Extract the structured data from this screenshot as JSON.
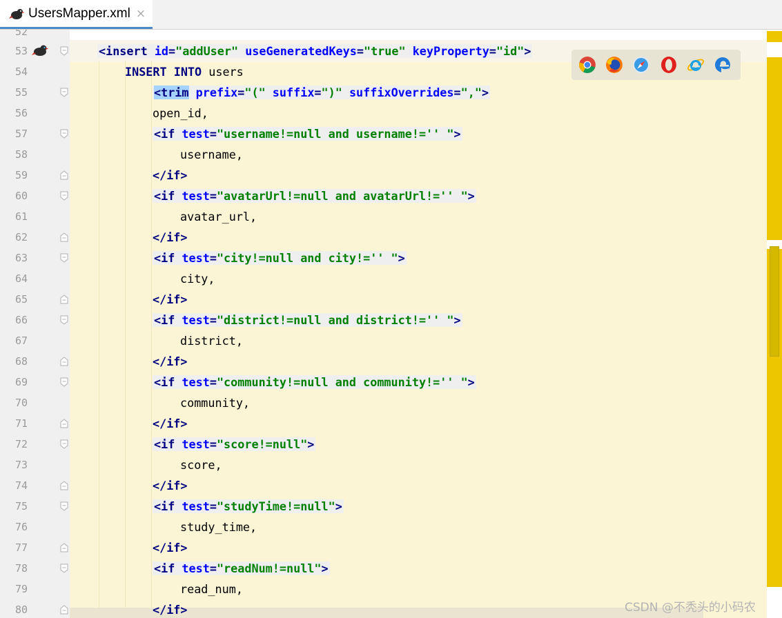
{
  "tab": {
    "title": "UsersMapper.xml",
    "close_glyph": "×",
    "icon": "mybatis-bird-icon"
  },
  "editor": {
    "first_partial_line_number": "52",
    "line_numbers": [
      "53",
      "54",
      "55",
      "56",
      "57",
      "58",
      "59",
      "60",
      "61",
      "62",
      "63",
      "64",
      "65",
      "66",
      "67",
      "68",
      "69",
      "70",
      "71",
      "72",
      "73",
      "74",
      "75",
      "76",
      "77",
      "78",
      "79",
      "80"
    ],
    "lines": [
      {
        "num": "53",
        "indent": 1,
        "boxed": true,
        "tokens": [
          [
            "t-tag",
            "<insert "
          ],
          [
            "t-attr",
            "id"
          ],
          [
            "t-tag",
            "="
          ],
          [
            "t-val",
            "\"addUser\" "
          ],
          [
            "t-attr",
            "useGeneratedKeys"
          ],
          [
            "t-tag",
            "="
          ],
          [
            "t-val",
            "\"true\" "
          ],
          [
            "t-attr",
            "keyProperty"
          ],
          [
            "t-tag",
            "="
          ],
          [
            "t-val",
            "\"id\""
          ],
          [
            "t-tag",
            ">"
          ]
        ]
      },
      {
        "num": "54",
        "indent": 2,
        "boxed": false,
        "tokens": [
          [
            "t-kw",
            "INSERT INTO "
          ],
          [
            "t-txt",
            "users"
          ]
        ]
      },
      {
        "num": "55",
        "indent": 3,
        "boxed": true,
        "tokens": [
          [
            "trim",
            "<trim"
          ],
          [
            "t-tag",
            " "
          ],
          [
            "t-attr",
            "prefix"
          ],
          [
            "t-tag",
            "="
          ],
          [
            "t-val",
            "\"(\" "
          ],
          [
            "t-attr",
            "suffix"
          ],
          [
            "t-tag",
            "="
          ],
          [
            "t-val",
            "\")\" "
          ],
          [
            "t-attr",
            "suffixOverrides"
          ],
          [
            "t-tag",
            "="
          ],
          [
            "t-val",
            "\",\""
          ],
          [
            "t-tag",
            ">"
          ]
        ]
      },
      {
        "num": "56",
        "indent": 3,
        "boxed": false,
        "tokens": [
          [
            "t-txt",
            "open_id,"
          ]
        ]
      },
      {
        "num": "57",
        "indent": 3,
        "boxed": true,
        "tokens": [
          [
            "t-tag",
            "<if "
          ],
          [
            "t-attr",
            "test"
          ],
          [
            "t-tag",
            "="
          ],
          [
            "t-val",
            "\"username!=null and username!='' \""
          ],
          [
            "t-tag",
            ">"
          ]
        ]
      },
      {
        "num": "58",
        "indent": 4,
        "boxed": false,
        "tokens": [
          [
            "t-txt",
            "username,"
          ]
        ]
      },
      {
        "num": "59",
        "indent": 3,
        "boxed": false,
        "tokens": [
          [
            "t-tag",
            "</if>"
          ]
        ]
      },
      {
        "num": "60",
        "indent": 3,
        "boxed": true,
        "tokens": [
          [
            "t-tag",
            "<if "
          ],
          [
            "t-attr",
            "test"
          ],
          [
            "t-tag",
            "="
          ],
          [
            "t-val",
            "\"avatarUrl!=null and avatarUrl!='' \""
          ],
          [
            "t-tag",
            ">"
          ]
        ]
      },
      {
        "num": "61",
        "indent": 4,
        "boxed": false,
        "tokens": [
          [
            "t-txt",
            "avatar_url,"
          ]
        ]
      },
      {
        "num": "62",
        "indent": 3,
        "boxed": false,
        "tokens": [
          [
            "t-tag",
            "</if>"
          ]
        ]
      },
      {
        "num": "63",
        "indent": 3,
        "boxed": true,
        "tokens": [
          [
            "t-tag",
            "<if "
          ],
          [
            "t-attr",
            "test"
          ],
          [
            "t-tag",
            "="
          ],
          [
            "t-val",
            "\"city!=null and city!='' \""
          ],
          [
            "t-tag",
            ">"
          ]
        ]
      },
      {
        "num": "64",
        "indent": 4,
        "boxed": false,
        "tokens": [
          [
            "t-txt",
            "city,"
          ]
        ]
      },
      {
        "num": "65",
        "indent": 3,
        "boxed": false,
        "tokens": [
          [
            "t-tag",
            "</if>"
          ]
        ]
      },
      {
        "num": "66",
        "indent": 3,
        "boxed": true,
        "tokens": [
          [
            "t-tag",
            "<if "
          ],
          [
            "t-attr",
            "test"
          ],
          [
            "t-tag",
            "="
          ],
          [
            "t-val",
            "\"district!=null and district!='' \""
          ],
          [
            "t-tag",
            ">"
          ]
        ]
      },
      {
        "num": "67",
        "indent": 4,
        "boxed": false,
        "tokens": [
          [
            "t-txt",
            "district,"
          ]
        ]
      },
      {
        "num": "68",
        "indent": 3,
        "boxed": false,
        "tokens": [
          [
            "t-tag",
            "</if>"
          ]
        ]
      },
      {
        "num": "69",
        "indent": 3,
        "boxed": true,
        "tokens": [
          [
            "t-tag",
            "<if "
          ],
          [
            "t-attr",
            "test"
          ],
          [
            "t-tag",
            "="
          ],
          [
            "t-val",
            "\"community!=null and community!='' \""
          ],
          [
            "t-tag",
            ">"
          ]
        ]
      },
      {
        "num": "70",
        "indent": 4,
        "boxed": false,
        "tokens": [
          [
            "t-txt",
            "community,"
          ]
        ]
      },
      {
        "num": "71",
        "indent": 3,
        "boxed": false,
        "tokens": [
          [
            "t-tag",
            "</if>"
          ]
        ]
      },
      {
        "num": "72",
        "indent": 3,
        "boxed": true,
        "tokens": [
          [
            "t-tag",
            "<if "
          ],
          [
            "t-attr",
            "test"
          ],
          [
            "t-tag",
            "="
          ],
          [
            "t-val",
            "\"score!=null\""
          ],
          [
            "t-tag",
            ">"
          ]
        ]
      },
      {
        "num": "73",
        "indent": 4,
        "boxed": false,
        "tokens": [
          [
            "t-txt",
            "score,"
          ]
        ]
      },
      {
        "num": "74",
        "indent": 3,
        "boxed": false,
        "tokens": [
          [
            "t-tag",
            "</if>"
          ]
        ]
      },
      {
        "num": "75",
        "indent": 3,
        "boxed": true,
        "tokens": [
          [
            "t-tag",
            "<if "
          ],
          [
            "t-attr",
            "test"
          ],
          [
            "t-tag",
            "="
          ],
          [
            "t-val",
            "\"studyTime!=null\""
          ],
          [
            "t-tag",
            ">"
          ]
        ]
      },
      {
        "num": "76",
        "indent": 4,
        "boxed": false,
        "tokens": [
          [
            "t-txt",
            "study_time,"
          ]
        ]
      },
      {
        "num": "77",
        "indent": 3,
        "boxed": false,
        "tokens": [
          [
            "t-tag",
            "</if>"
          ]
        ]
      },
      {
        "num": "78",
        "indent": 3,
        "boxed": true,
        "tokens": [
          [
            "t-tag",
            "<if "
          ],
          [
            "t-attr",
            "test"
          ],
          [
            "t-tag",
            "="
          ],
          [
            "t-val",
            "\"readNum!=null\""
          ],
          [
            "t-tag",
            ">"
          ]
        ]
      },
      {
        "num": "79",
        "indent": 4,
        "boxed": false,
        "tokens": [
          [
            "t-txt",
            "read_num,"
          ]
        ]
      },
      {
        "num": "80",
        "indent": 3,
        "boxed": false,
        "tokens": [
          [
            "t-tag",
            "</if>"
          ]
        ]
      }
    ],
    "fold_markers": {
      "53": "open",
      "55": "open",
      "57": "open",
      "59": "close",
      "60": "open",
      "62": "close",
      "63": "open",
      "65": "close",
      "66": "open",
      "68": "close",
      "69": "open",
      "71": "close",
      "72": "open",
      "74": "close",
      "75": "open",
      "77": "close",
      "78": "open",
      "80": "close"
    }
  },
  "browser_icons": [
    "chrome-icon",
    "firefox-icon",
    "safari-icon",
    "opera-icon",
    "internet-explorer-icon",
    "edge-icon"
  ],
  "colors": {
    "tag": "#000080",
    "attribute": "#0000ff",
    "value": "#008000",
    "background": "#fbf4d5",
    "marker_strip": "#edc600"
  },
  "watermark": "CSDN @不秃头的小码农"
}
